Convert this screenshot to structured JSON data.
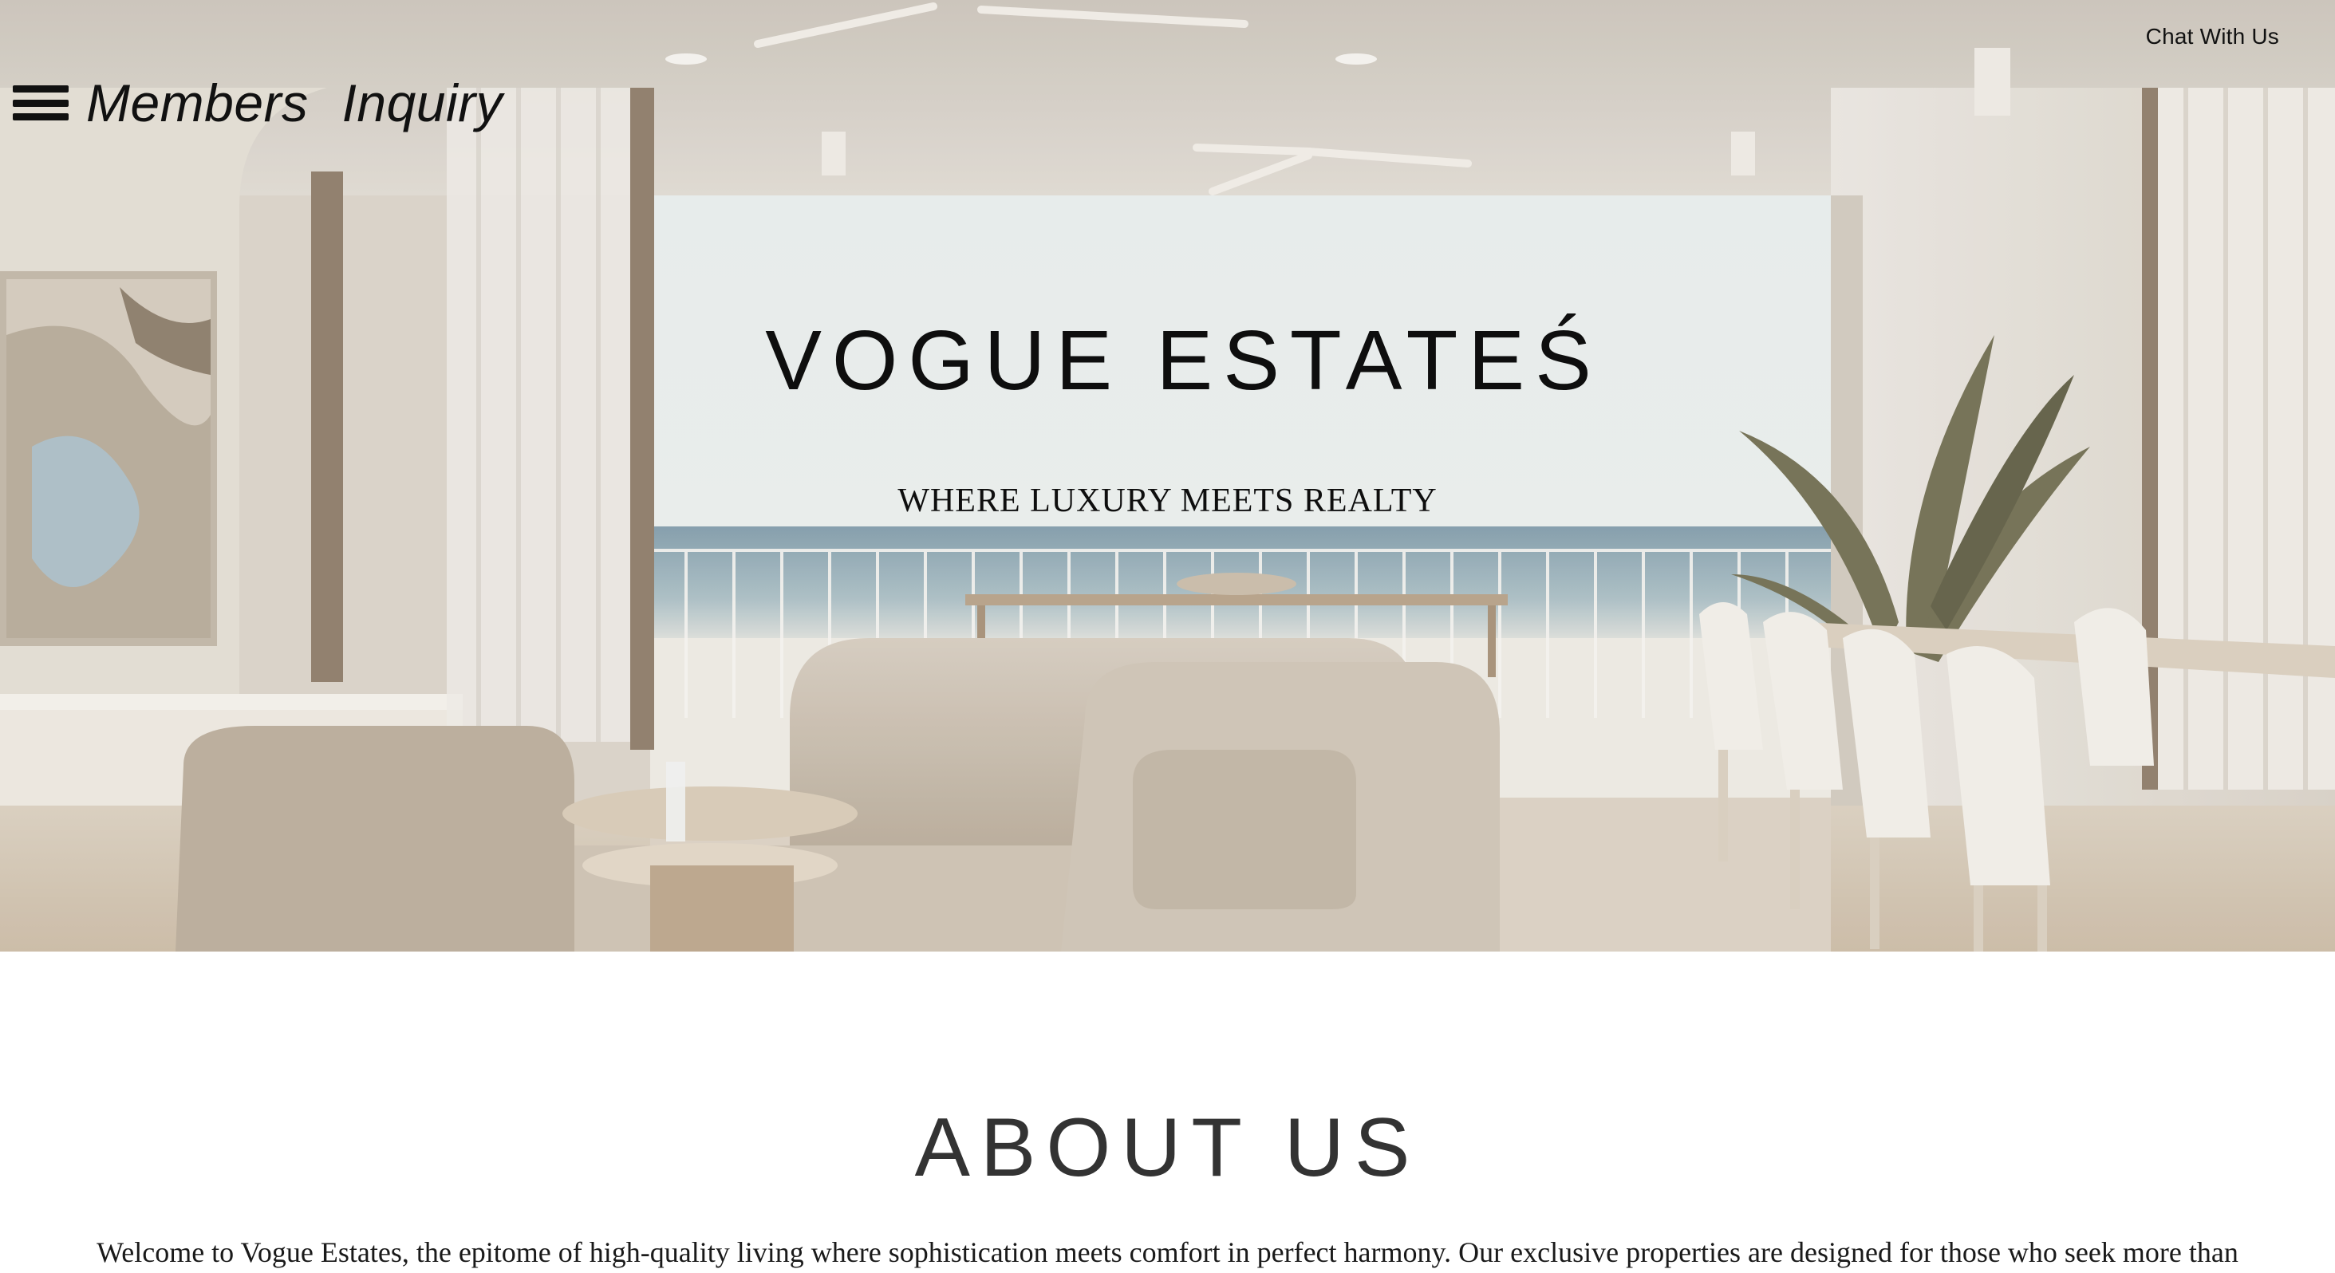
{
  "header": {
    "chat_label": "Chat With Us",
    "nav": {
      "members_label": "Members",
      "inquiry_label": "Inquiry"
    }
  },
  "hero": {
    "title": "VOGUE ESTATEŚ",
    "subtitle": "WHERE LUXURY MEETS REALTY",
    "image": "living-room-ocean-view-photo"
  },
  "about": {
    "title": "ABOUT US",
    "text": "Welcome to Vogue Estates, the epitome of high-quality living where sophistication meets comfort in perfect harmony. Our exclusive properties are designed for those who seek more than"
  },
  "colors": {
    "text_dark": "#111111",
    "heading_gray": "#333333",
    "background": "#ffffff"
  }
}
